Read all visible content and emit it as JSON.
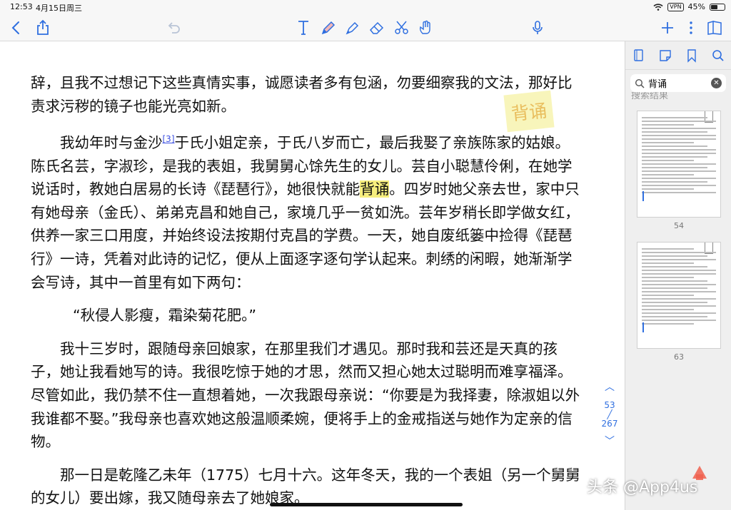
{
  "status": {
    "time": "12:53",
    "date": "4月15日周三",
    "vpn": "VPN",
    "battery": "45%",
    "battery_level_percent": 45
  },
  "toolbar": {
    "icons": [
      "back-icon",
      "share-icon",
      "undo-icon",
      "text-tool-icon",
      "pen-icon",
      "highlighter-icon",
      "eraser-icon",
      "scissors-icon",
      "hand-icon",
      "microphone-icon",
      "add-icon",
      "more-icon",
      "notebook-icon"
    ]
  },
  "document": {
    "paragraphs": [
      {
        "parts": [
          "辞，且我不过想记下这些真情实事，诚愿读者多有包涵，勿要细察我的文法，那好比责求污秽的镜子也能光亮如新。"
        ]
      },
      {
        "before": "我幼年时与金沙",
        "footnote": "[3]",
        "middle": "于氏小姐定亲，于氏八岁而亡，最后我娶了亲族陈家的姑娘。陈氏名芸，字淑珍，是我的表姐，我舅舅心馀先生的女儿。芸自小聪慧伶俐，在她学说话时，教她白居易的长诗《琵琶行》，她很快就能",
        "highlight": "背诵",
        "after": "。四岁时她父亲去世，家中只有她母亲（金氏）、弟弟克昌和她自己，家境几乎一贫如洗。芸年岁稍长即学做女红，供养一家三口用度，并始终设法按期付克昌的学费。一天，她自废纸篓中捡得《琵琶行》一诗，凭着对此诗的记忆，便从上面逐字逐句学认起来。刺绣的闲暇，她渐渐学会写诗，其中一首里有如下两句："
      },
      {
        "poem": "“秋侵人影瘦，霜染菊花肥。”"
      },
      {
        "text": "我十三岁时，跟随母亲回娘家，在那里我们才遇见。那时我和芸还是天真的孩子，她让我看她写的诗。我很吃惊于她的才思，然而又担心她太过聪明而难享福泽。尽管如此，我仍禁不住一直想着她，一次我跟母亲说：“你要是为我择妻，除淑姐以外我谁都不娶。”我母亲也喜欢她这般温顺柔婉，便将手上的金戒指送与她作为定亲的信物。"
      },
      {
        "text": "那一日是乾隆乙未年（1775）七月十六。这年冬天，我的一个表姐（另一个舅舅的女儿）要出嫁，我又随母亲去了她娘家。"
      }
    ],
    "handwritten_note": "背诵"
  },
  "page_nav": {
    "current": "53",
    "total": "267"
  },
  "sidebar": {
    "search_query": "背诵",
    "results_header": "搜索结果",
    "thumbnails": [
      {
        "page": "54"
      },
      {
        "page": "63"
      }
    ]
  },
  "watermark": "头条 @App4us"
}
